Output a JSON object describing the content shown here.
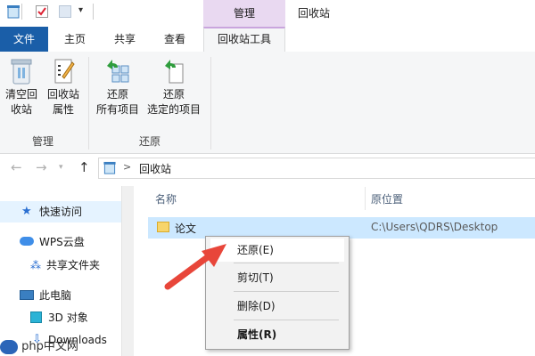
{
  "titlebar": {
    "contextual_group": "管理",
    "window_title": "回收站"
  },
  "ribbon_tabs": {
    "file": "文件",
    "home": "主页",
    "share": "共享",
    "view": "查看",
    "recycle_tools": "回收站工具"
  },
  "ribbon": {
    "empty_bin": [
      "清空回",
      "收站"
    ],
    "bin_properties": [
      "回收站",
      "属性"
    ],
    "restore_all": [
      "还原",
      "所有项目"
    ],
    "restore_selected": [
      "还原",
      "选定的项目"
    ],
    "group_manage": "管理",
    "group_restore": "还原"
  },
  "address": {
    "separator": ">",
    "location": "回收站"
  },
  "nav_pane": {
    "quick_access": "快速访问",
    "wps_cloud": "WPS云盘",
    "shared_folder": "共享文件夹",
    "this_pc": "此电脑",
    "objects_3d": "3D 对象",
    "downloads": "Downloads"
  },
  "file_list": {
    "col_name": "名称",
    "col_origin": "原位置",
    "rows": [
      {
        "name": "论文",
        "origin": "C:\\Users\\QDRS\\Desktop"
      }
    ]
  },
  "context_menu": {
    "items": [
      "还原(E)",
      "剪切(T)",
      "删除(D)",
      "属性(R)"
    ]
  },
  "watermark": {
    "text": "php中文网"
  },
  "colors": {
    "file_tab": "#1a5ea8",
    "contextual": "#e9d9f1",
    "selection": "#cce8ff",
    "arrow": "#e8463a"
  }
}
